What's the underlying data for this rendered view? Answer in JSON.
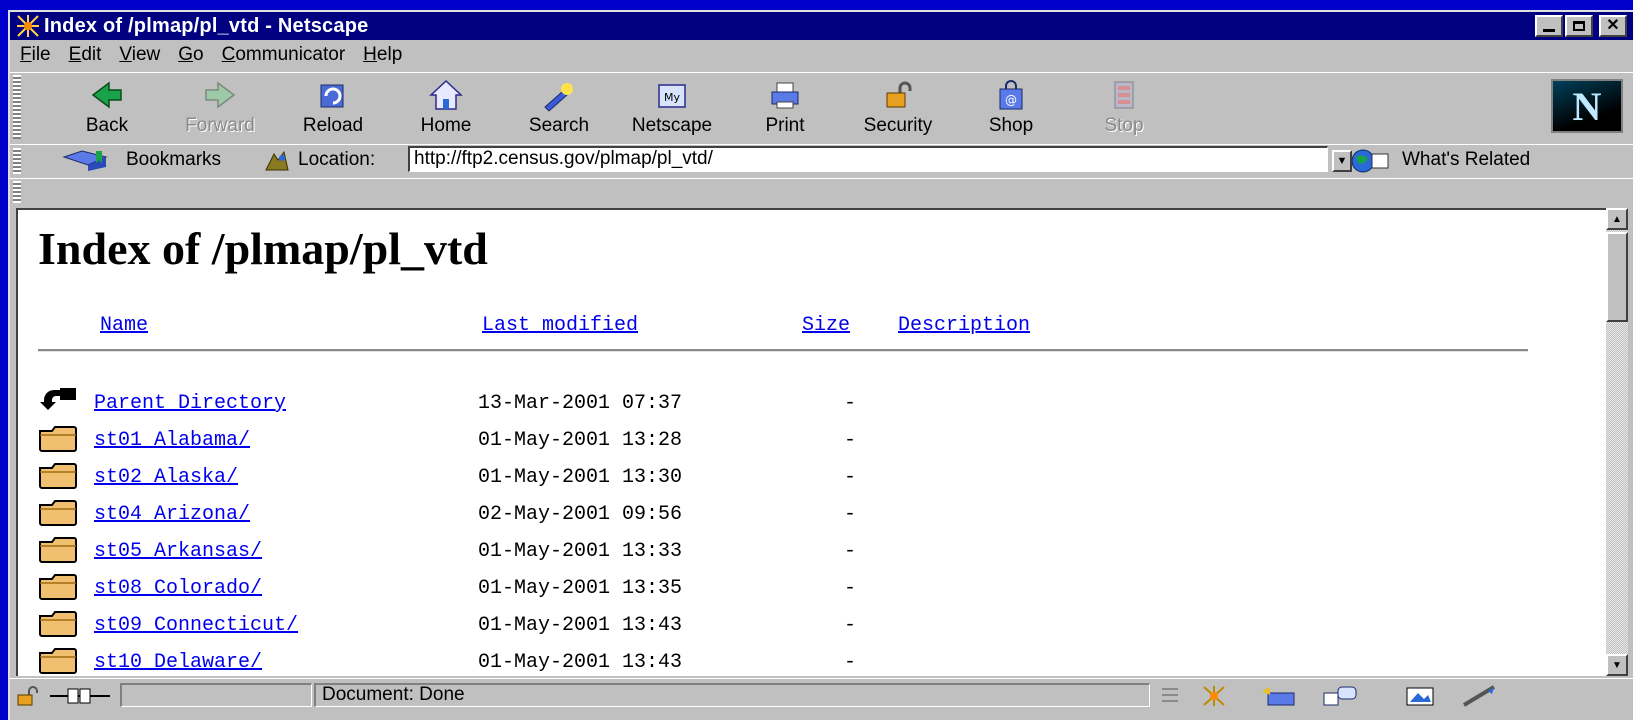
{
  "window": {
    "title": "Index of /plmap/pl_vtd - Netscape",
    "controls": [
      "minimize",
      "maximize",
      "close"
    ]
  },
  "menu": [
    "File",
    "Edit",
    "View",
    "Go",
    "Communicator",
    "Help"
  ],
  "toolbar": [
    {
      "label": "Back",
      "icon": "back-arrow-icon",
      "enabled": true
    },
    {
      "label": "Forward",
      "icon": "forward-arrow-icon",
      "enabled": false
    },
    {
      "label": "Reload",
      "icon": "reload-icon",
      "enabled": true
    },
    {
      "label": "Home",
      "icon": "home-icon",
      "enabled": true
    },
    {
      "label": "Search",
      "icon": "search-flashlight-icon",
      "enabled": true
    },
    {
      "label": "Netscape",
      "icon": "my-netscape-icon",
      "enabled": true
    },
    {
      "label": "Print",
      "icon": "printer-icon",
      "enabled": true
    },
    {
      "label": "Security",
      "icon": "padlock-icon",
      "enabled": true
    },
    {
      "label": "Shop",
      "icon": "shopping-bag-icon",
      "enabled": true
    },
    {
      "label": "Stop",
      "icon": "stop-icon",
      "enabled": false
    }
  ],
  "location": {
    "bookmarks_label": "Bookmarks",
    "location_label": "Location:",
    "url": "http://ftp2.census.gov/plmap/pl_vtd/",
    "whats_related": "What's Related"
  },
  "page": {
    "heading": "Index of /plmap/pl_vtd",
    "columns": {
      "name": "Name",
      "modified": "Last modified",
      "size": "Size",
      "description": "Description"
    },
    "entries": [
      {
        "name": "Parent Directory",
        "modified": "13-Mar-2001 07:37",
        "size": "-",
        "type": "parent"
      },
      {
        "name": "st01 Alabama/",
        "modified": "01-May-2001 13:28",
        "size": "-",
        "type": "folder"
      },
      {
        "name": "st02 Alaska/",
        "modified": "01-May-2001 13:30",
        "size": "-",
        "type": "folder"
      },
      {
        "name": "st04 Arizona/",
        "modified": "02-May-2001 09:56",
        "size": "-",
        "type": "folder"
      },
      {
        "name": "st05 Arkansas/",
        "modified": "01-May-2001 13:33",
        "size": "-",
        "type": "folder"
      },
      {
        "name": "st08 Colorado/",
        "modified": "01-May-2001 13:35",
        "size": "-",
        "type": "folder"
      },
      {
        "name": "st09 Connecticut/",
        "modified": "01-May-2001 13:43",
        "size": "-",
        "type": "folder"
      },
      {
        "name": "st10 Delaware/",
        "modified": "01-May-2001 13:43",
        "size": "-",
        "type": "folder"
      }
    ]
  },
  "status": {
    "text": "Document: Done"
  },
  "colors": {
    "desktop": "#0000cc",
    "titlebar": "#000080",
    "chrome": "#c0c0c0",
    "link": "#0000ee"
  }
}
